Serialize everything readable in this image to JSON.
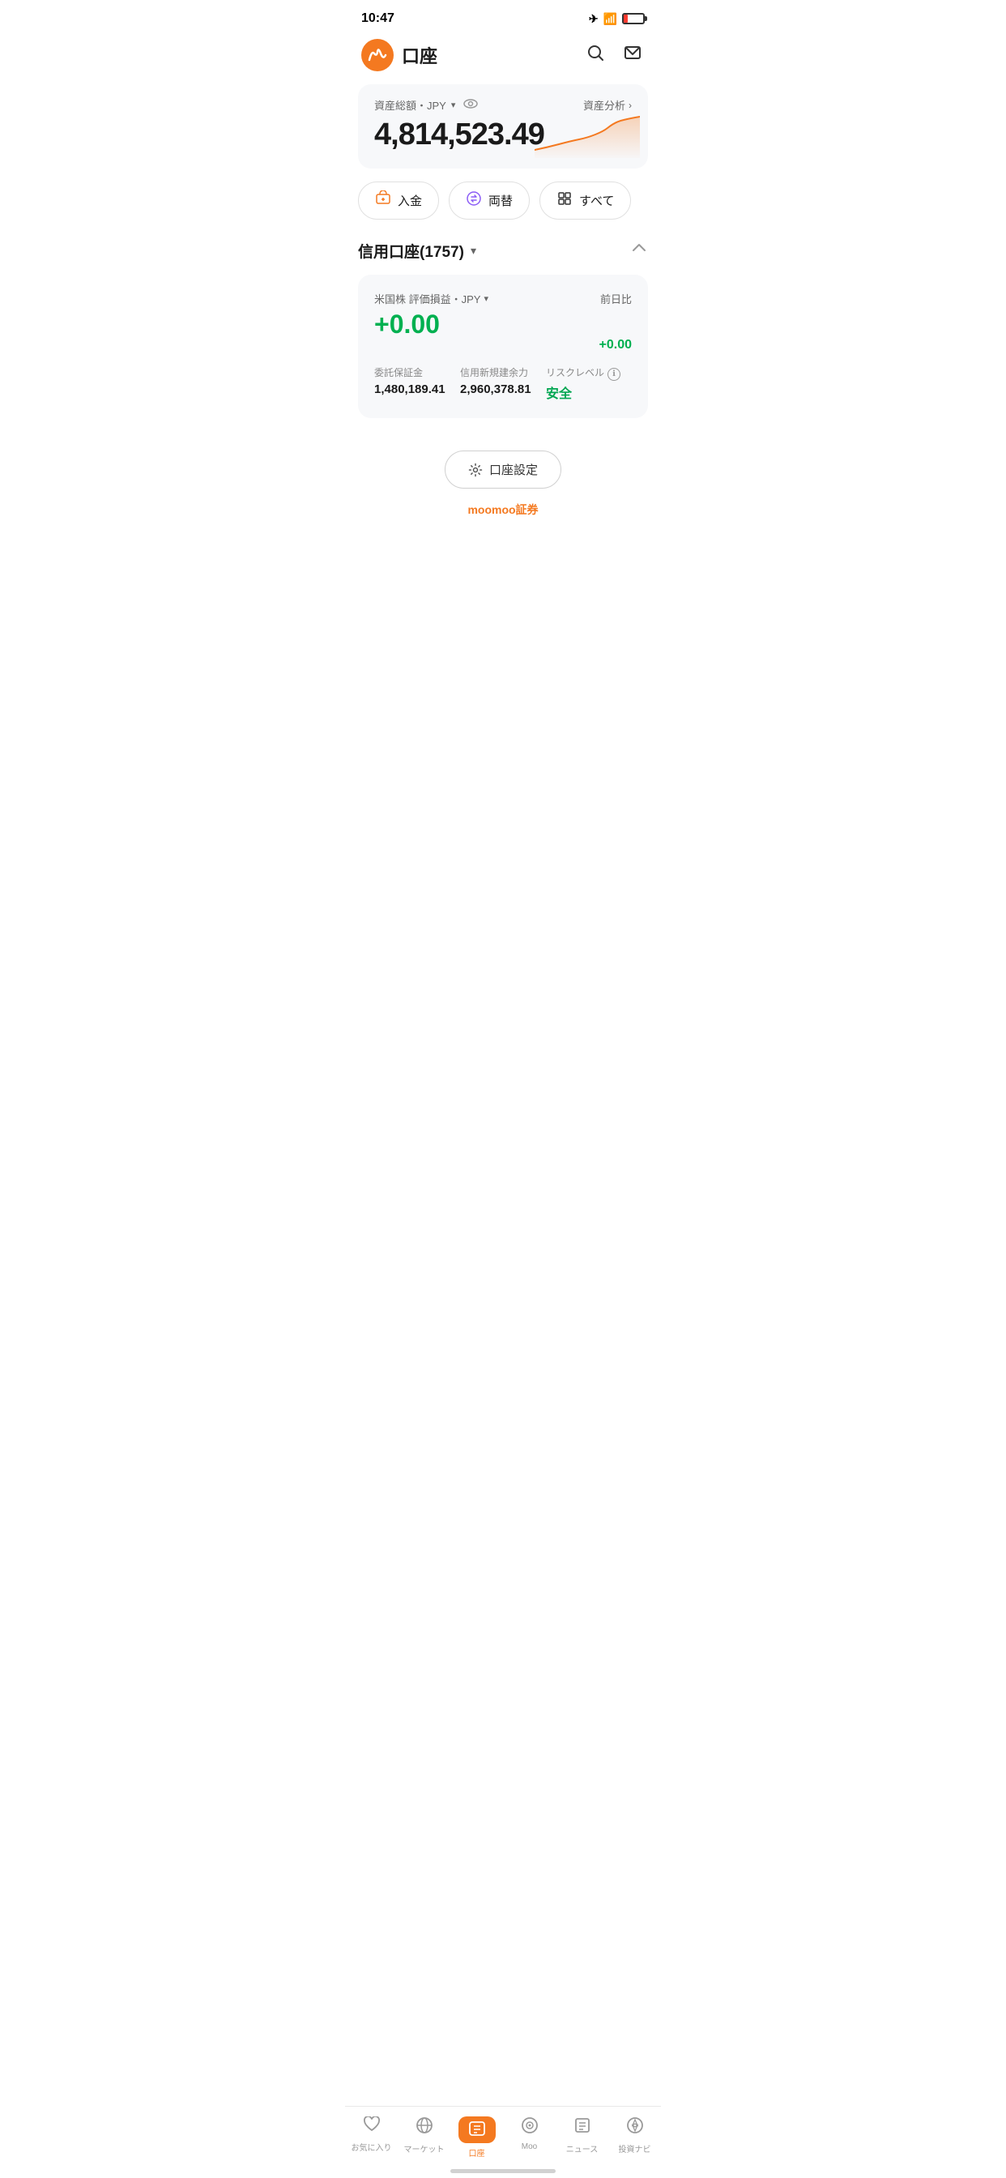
{
  "statusBar": {
    "time": "10:47"
  },
  "header": {
    "title": "口座",
    "searchLabel": "検索",
    "messageLabel": "メッセージ"
  },
  "assetCard": {
    "labelPrefix": "資産総額・JPY",
    "analysisLink": "資産分析",
    "amount": "4,814,523.49",
    "eyeIcon": "👁"
  },
  "actionButtons": [
    {
      "id": "deposit",
      "icon": "💰",
      "label": "入金"
    },
    {
      "id": "exchange",
      "icon": "💱",
      "label": "両替"
    },
    {
      "id": "all",
      "icon": "⊞",
      "label": "すべて"
    }
  ],
  "section": {
    "title": "信用口座(1757)",
    "collapseIcon": "∧"
  },
  "accountCard": {
    "stockLabel": "米国株 評価損益・JPY",
    "dateLabel": "前日比",
    "pnl": "+0.00",
    "pnlRight": "+0.00",
    "details": [
      {
        "label": "委託保証金",
        "value": "1,480,189.41"
      },
      {
        "label": "信用新規建余力",
        "value": "2,960,378.81"
      },
      {
        "label": "リスクレベル",
        "value": "安全",
        "safe": true
      }
    ]
  },
  "settingsBtn": {
    "icon": "⚙",
    "label": "口座設定"
  },
  "brand": "moomoo証券",
  "bottomNav": {
    "items": [
      {
        "id": "favorites",
        "icon": "♡",
        "label": "お気に入り",
        "active": false
      },
      {
        "id": "market",
        "icon": "🪐",
        "label": "マーケット",
        "active": false
      },
      {
        "id": "account",
        "icon": "▤",
        "label": "口座",
        "active": true
      },
      {
        "id": "moo",
        "icon": "◎",
        "label": "Moo",
        "active": false
      },
      {
        "id": "news",
        "icon": "☰",
        "label": "ニュース",
        "active": false
      },
      {
        "id": "navi",
        "icon": "◎",
        "label": "投資ナビ",
        "active": false
      }
    ]
  }
}
